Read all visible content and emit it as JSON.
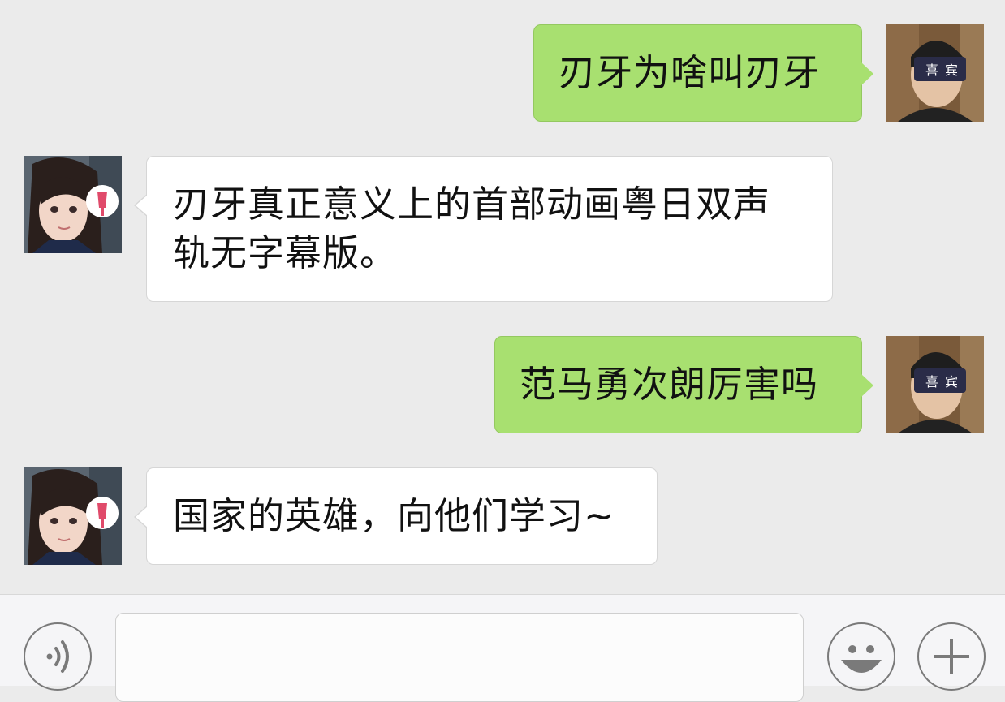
{
  "conversation": {
    "messages": [
      {
        "sender": "me",
        "text": "刃牙为啥叫刃牙"
      },
      {
        "sender": "other",
        "text": "刃牙真正意义上的首部动画粤日双声轨无字幕版。"
      },
      {
        "sender": "me",
        "text": "范马勇次朗厉害吗"
      },
      {
        "sender": "other",
        "text": "国家的英雄，向他们学习~"
      }
    ]
  },
  "avatars": {
    "me": {
      "mask_text_left": "喜",
      "mask_text_right": "宾"
    }
  },
  "input_bar": {
    "voice_icon": "voice-icon",
    "emoji_icon": "emoji-icon",
    "plus_icon": "plus-icon",
    "input_value": ""
  },
  "colors": {
    "background": "#ebebeb",
    "outgoing_bubble": "#a8e070",
    "incoming_bubble": "#ffffff"
  }
}
